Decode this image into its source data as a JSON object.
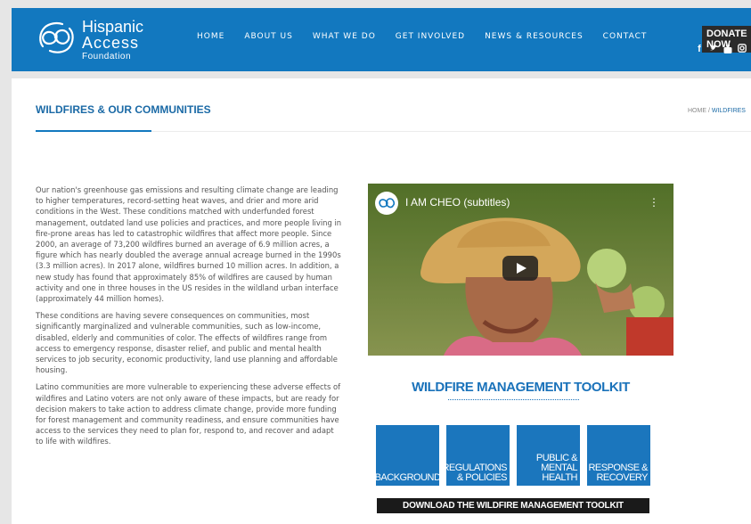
{
  "header": {
    "logo": {
      "line1": "Hispanic",
      "line2": "Access",
      "line3": "Foundation"
    },
    "nav": [
      "HOME",
      "ABOUT US",
      "WHAT WE DO",
      "GET INVOLVED",
      "NEWS & RESOURCES",
      "CONTACT"
    ],
    "donate_label": "DONATE NOW",
    "social_icons": [
      "facebook-icon",
      "twitter-icon",
      "youtube-icon",
      "instagram-icon",
      "search-icon"
    ]
  },
  "page": {
    "title": "WILDFIRES & OUR COMMUNITIES",
    "breadcrumb": {
      "home": "HOME",
      "separator": "/",
      "current": "WILDFIRES"
    }
  },
  "body_paragraphs": [
    "Our nation's greenhouse gas emissions and resulting climate change are leading to higher temperatures, record-setting heat waves, and drier and more arid conditions in the West. These conditions matched with underfunded forest management, outdated land use policies and practices, and more people living in fire-prone areas has led to catastrophic wildfires that affect more people. Since 2000, an average of 73,200 wildfires burned an average of 6.9 million acres, a figure which has nearly doubled the average annual acreage burned in the 1990s (3.3 million acres). In 2017 alone, wildfires burned 10 million acres. In addition, a new study has found that approximately 85% of wildfires are caused by human activity and one in three houses in the US resides in the wildland urban interface (approximately 44 million homes).",
    "These conditions are having severe consequences on communities, most significantly marginalized and vulnerable communities, such as low-income, disabled, elderly and communities of color. The effects of wildfires range from access to emergency response, disaster relief, and public and mental health services to job security, economic productivity, land use planning and affordable housing.",
    "Latino communities are more vulnerable to experiencing these adverse effects of wildfires and Latino voters are not only aware of these impacts, but are ready for decision makers to take action to address climate change, provide more funding for forest management and community readiness, and ensure communities have access to the services they need to plan for, respond to, and recover and adapt to life with wildfires."
  ],
  "video": {
    "title": "I AM CHEO (subtitles)"
  },
  "toolkit": {
    "title": "WILDFIRE MANAGEMENT TOOLKIT",
    "tiles": [
      {
        "line1": "BACKGROUND",
        "line2": ""
      },
      {
        "line1": "REGULATIONS",
        "line2": "& POLICIES"
      },
      {
        "line1": "PUBLIC &",
        "line2": "MENTAL HEALTH"
      },
      {
        "line1": "RESPONSE &",
        "line2": "RECOVERY"
      }
    ],
    "download_label": "DOWNLOAD THE WILDFIRE MANAGEMENT TOOLKIT"
  },
  "colors": {
    "brand_blue": "#1278bf",
    "title_blue": "#1b6aa6",
    "tile_blue": "#1b76bd"
  }
}
